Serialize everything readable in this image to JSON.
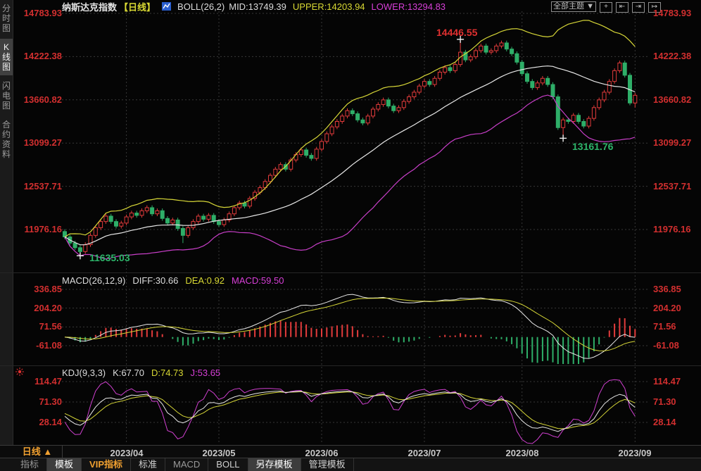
{
  "header": {
    "title": "纳斯达克指数",
    "period_tag": "【日线】",
    "indicator": "BOLL(26,2)",
    "mid": "MID:13749.39",
    "upper": "UPPER:14203.94",
    "lower": "LOWER:13294.83",
    "theme_dropdown": "全部主题 ▼",
    "tools": [
      {
        "name": "crosshair",
        "glyph": "+"
      },
      {
        "name": "scale-compress-left",
        "glyph": "⇤"
      },
      {
        "name": "scale-compress-right",
        "glyph": "⇥"
      },
      {
        "name": "pan-right",
        "glyph": "↦"
      }
    ]
  },
  "sidebar": {
    "tabs": [
      {
        "label": "分时图"
      },
      {
        "label": "K线图"
      },
      {
        "label": "闪电图"
      },
      {
        "label": "合约资料"
      }
    ]
  },
  "main_panel": {
    "y_labels": [
      "14783.93",
      "14222.38",
      "13660.82",
      "13099.27",
      "12537.71",
      "11976.16"
    ],
    "annotations": {
      "high": "14446.55",
      "aug_low": "13161.76",
      "apr_low": "11635.03"
    }
  },
  "macd_panel": {
    "name": "MACD(26,12,9)",
    "diff": "DIFF:30.66",
    "dea": "DEA:0.92",
    "macd": "MACD:59.50",
    "y_labels": [
      "336.85",
      "204.20",
      "71.56",
      "-61.08"
    ]
  },
  "kdj_panel": {
    "name": "KDJ(9,3,3)",
    "k": "K:67.70",
    "d": "D:74.73",
    "j": "J:53.65",
    "y_labels": [
      "114.47",
      "71.30",
      "28.14"
    ]
  },
  "x_axis": {
    "period_button": "日线 ▲",
    "labels": [
      "2023/04",
      "2023/05",
      "2023/06",
      "2023/07",
      "2023/08",
      "2023/09"
    ]
  },
  "bottom_tabs": [
    {
      "label": "指标"
    },
    {
      "label": "模板"
    },
    {
      "label": "VIP指标"
    },
    {
      "label": "标准"
    },
    {
      "label": "MACD"
    },
    {
      "label": "BOLL"
    },
    {
      "label": "另存模板"
    },
    {
      "label": "管理模板"
    }
  ],
  "colors": {
    "up": "#e23b3b",
    "down": "#2eae68",
    "boll_mid": "#e8e8e8",
    "boll_upper": "#d6d637",
    "boll_lower": "#c93fc9",
    "diff_line": "#e8e8e8",
    "dea_line": "#d6d637",
    "k_line": "#e8e8e8",
    "d_line": "#d6d637",
    "j_line": "#d040d0",
    "grid": "#383838",
    "marker": "#f0f0f0"
  },
  "chart_data": {
    "type": "candlestick",
    "title": "纳斯达克指数 日线 (NASDAQ index, daily)",
    "candle_format": "[open,high,low,close]",
    "price_ticks": [
      14783.93,
      14222.38,
      13660.82,
      13099.27,
      12537.71,
      11976.16
    ],
    "macd_ticks": [
      336.85,
      204.2,
      71.56,
      -61.08
    ],
    "kdj_ticks": [
      114.47,
      71.3,
      28.14
    ],
    "x_ticks": [
      {
        "index": 12,
        "label": "2023/04"
      },
      {
        "index": 30,
        "label": "2023/05"
      },
      {
        "index": 50,
        "label": "2023/06"
      },
      {
        "index": 70,
        "label": "2023/07"
      },
      {
        "index": 89,
        "label": "2023/08"
      },
      {
        "index": 111,
        "label": "2023/09"
      }
    ],
    "indicators": {
      "boll": {
        "period": 26,
        "width": 2,
        "mid": 13749.39,
        "upper": 14203.94,
        "lower": 13294.83
      },
      "macd": {
        "fast": 12,
        "slow": 26,
        "signal": 9,
        "diff": 30.66,
        "dea": 0.92,
        "macd": 59.5
      },
      "kdj": {
        "params": [
          9,
          3,
          3
        ],
        "k": 67.7,
        "d": 74.73,
        "j": 53.65
      }
    },
    "annotations": [
      {
        "label": "14446.55",
        "index": 77,
        "price": 14446.55,
        "type": "high"
      },
      {
        "label": "13161.76",
        "index": 97,
        "price": 13161.76,
        "type": "low"
      },
      {
        "label": "11635.03",
        "index": 3,
        "price": 11635.03,
        "type": "low"
      }
    ],
    "candles": [
      [
        11950,
        11980,
        11850,
        11880
      ],
      [
        11880,
        11910,
        11770,
        11800
      ],
      [
        11800,
        11830,
        11710,
        11740
      ],
      [
        11740,
        11770,
        11635,
        11690
      ],
      [
        11690,
        11810,
        11660,
        11780
      ],
      [
        11780,
        11930,
        11750,
        11900
      ],
      [
        11900,
        12030,
        11870,
        12000
      ],
      [
        12000,
        12110,
        11970,
        12080
      ],
      [
        12080,
        12180,
        12050,
        12150
      ],
      [
        12150,
        12180,
        12050,
        12080
      ],
      [
        12080,
        12110,
        11990,
        12020
      ],
      [
        12020,
        12090,
        11990,
        12060
      ],
      [
        12060,
        12170,
        12030,
        12140
      ],
      [
        12140,
        12220,
        12110,
        12190
      ],
      [
        12190,
        12220,
        12130,
        12160
      ],
      [
        12160,
        12250,
        12130,
        12220
      ],
      [
        12220,
        12290,
        12190,
        12260
      ],
      [
        12260,
        12290,
        12150,
        12180
      ],
      [
        12180,
        12250,
        12150,
        12220
      ],
      [
        12220,
        12250,
        12090,
        12120
      ],
      [
        12120,
        12150,
        12030,
        12060
      ],
      [
        12060,
        12130,
        12030,
        12100
      ],
      [
        12100,
        12130,
        11960,
        11990
      ],
      [
        11990,
        12020,
        11800,
        11900
      ],
      [
        11900,
        12030,
        11870,
        12000
      ],
      [
        12000,
        12110,
        11970,
        12080
      ],
      [
        12080,
        12180,
        12050,
        12150
      ],
      [
        12150,
        12180,
        12080,
        12110
      ],
      [
        12110,
        12190,
        12080,
        12160
      ],
      [
        12160,
        12190,
        12050,
        12080
      ],
      [
        12080,
        12110,
        12010,
        12040
      ],
      [
        12040,
        12130,
        12010,
        12100
      ],
      [
        12100,
        12210,
        12070,
        12180
      ],
      [
        12180,
        12290,
        12150,
        12260
      ],
      [
        12260,
        12350,
        12230,
        12320
      ],
      [
        12320,
        12350,
        12250,
        12280
      ],
      [
        12280,
        12410,
        12250,
        12380
      ],
      [
        12380,
        12490,
        12350,
        12460
      ],
      [
        12460,
        12550,
        12430,
        12520
      ],
      [
        12520,
        12630,
        12490,
        12600
      ],
      [
        12600,
        12710,
        12570,
        12680
      ],
      [
        12680,
        12790,
        12650,
        12760
      ],
      [
        12760,
        12850,
        12730,
        12820
      ],
      [
        12820,
        12850,
        12730,
        12760
      ],
      [
        12760,
        12910,
        12730,
        12880
      ],
      [
        12880,
        12980,
        12850,
        12950
      ],
      [
        12950,
        13040,
        12920,
        13010
      ],
      [
        13010,
        13040,
        12910,
        12940
      ],
      [
        12940,
        12970,
        12870,
        12900
      ],
      [
        12900,
        13050,
        12870,
        13020
      ],
      [
        13020,
        13150,
        12990,
        13120
      ],
      [
        13120,
        13250,
        13090,
        13220
      ],
      [
        13220,
        13340,
        13190,
        13310
      ],
      [
        13310,
        13410,
        13280,
        13380
      ],
      [
        13380,
        13480,
        13350,
        13450
      ],
      [
        13450,
        13550,
        13420,
        13520
      ],
      [
        13520,
        13550,
        13450,
        13480
      ],
      [
        13480,
        13510,
        13370,
        13400
      ],
      [
        13400,
        13430,
        13330,
        13360
      ],
      [
        13360,
        13480,
        13330,
        13450
      ],
      [
        13450,
        13570,
        13420,
        13540
      ],
      [
        13540,
        13630,
        13510,
        13600
      ],
      [
        13600,
        13690,
        13570,
        13660
      ],
      [
        13660,
        13690,
        13550,
        13580
      ],
      [
        13580,
        13610,
        13490,
        13520
      ],
      [
        13520,
        13590,
        13490,
        13560
      ],
      [
        13560,
        13670,
        13530,
        13640
      ],
      [
        13640,
        13730,
        13610,
        13700
      ],
      [
        13700,
        13790,
        13670,
        13760
      ],
      [
        13760,
        13870,
        13730,
        13840
      ],
      [
        13840,
        13930,
        13810,
        13900
      ],
      [
        13900,
        13930,
        13830,
        13860
      ],
      [
        13860,
        13970,
        13830,
        13940
      ],
      [
        13940,
        14050,
        13910,
        14020
      ],
      [
        14020,
        14110,
        13990,
        14080
      ],
      [
        14080,
        14110,
        14010,
        14040
      ],
      [
        14040,
        14150,
        14010,
        14120
      ],
      [
        14120,
        14446,
        14090,
        14280
      ],
      [
        14280,
        14310,
        14150,
        14180
      ],
      [
        14180,
        14250,
        14150,
        14220
      ],
      [
        14220,
        14330,
        14190,
        14300
      ],
      [
        14300,
        14390,
        14270,
        14360
      ],
      [
        14360,
        14390,
        14250,
        14280
      ],
      [
        14280,
        14330,
        14250,
        14300
      ],
      [
        14300,
        14390,
        14270,
        14360
      ],
      [
        14360,
        14430,
        14330,
        14400
      ],
      [
        14400,
        14430,
        14290,
        14320
      ],
      [
        14320,
        14350,
        14230,
        14260
      ],
      [
        14260,
        14290,
        14120,
        14150
      ],
      [
        14150,
        14180,
        13970,
        14000
      ],
      [
        14000,
        14030,
        13870,
        13900
      ],
      [
        13900,
        13930,
        13790,
        13820
      ],
      [
        13820,
        13910,
        13790,
        13880
      ],
      [
        13880,
        13970,
        13850,
        13940
      ],
      [
        13940,
        13970,
        13830,
        13860
      ],
      [
        13860,
        13890,
        13670,
        13700
      ],
      [
        13700,
        13730,
        13270,
        13300
      ],
      [
        13300,
        13430,
        13161,
        13400
      ],
      [
        13400,
        13430,
        13350,
        13380
      ],
      [
        13380,
        13490,
        13350,
        13460
      ],
      [
        13460,
        13490,
        13350,
        13380
      ],
      [
        13380,
        13410,
        13290,
        13320
      ],
      [
        13320,
        13450,
        13290,
        13420
      ],
      [
        13420,
        13590,
        13390,
        13560
      ],
      [
        13560,
        13690,
        13530,
        13660
      ],
      [
        13660,
        13790,
        13630,
        13760
      ],
      [
        13760,
        13930,
        13730,
        13900
      ],
      [
        13900,
        14070,
        13870,
        14040
      ],
      [
        14040,
        14170,
        14010,
        14140
      ],
      [
        14140,
        14170,
        13950,
        13980
      ],
      [
        13980,
        14010,
        13590,
        13620
      ],
      [
        13620,
        13750,
        13560,
        13720
      ]
    ]
  }
}
